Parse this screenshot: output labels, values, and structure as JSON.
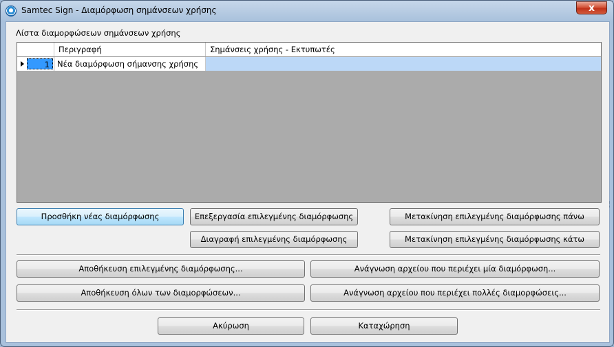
{
  "window": {
    "title": "Samtec Sign - Διαμόρφωση σημάνσεων χρήσης",
    "close_glyph": "x",
    "icon": "samtec-app-icon"
  },
  "group": {
    "label": "Λίστα διαμορφώσεων σημάνσεων χρήσης"
  },
  "grid": {
    "columns": [
      "Περιγραφή",
      "Σημάνσεις χρήσης - Εκτυπωτές"
    ],
    "rows": [
      {
        "number": "1",
        "description": "Νέα διαμόρφωση σήμανσης χρήσης",
        "labels_printers": ""
      }
    ]
  },
  "buttons": {
    "add": "Προσθήκη νέας διαμόρφωσης",
    "edit": "Επεξεργασία επιλεγμένης διαμόρφωσης",
    "delete": "Διαγραφή επιλεγμένης διαμόρφωσης",
    "move_up": "Μετακίνηση επιλεγμένης διαμόρφωσης πάνω",
    "move_down": "Μετακίνηση επιλεγμένης διαμόρφωσης κάτω",
    "save_selected": "Αποθήκευση επιλεγμένης διαμόρφωσης...",
    "save_all": "Αποθήκευση όλων των διαμορφώσεων...",
    "read_single": "Ανάγνωση αρχείου που περιέχει μία διαμόρφωση...",
    "read_multiple": "Ανάγνωση αρχείου που περιέχει πολλές διαμορφώσεις...",
    "cancel": "Ακύρωση",
    "submit": "Καταχώρηση"
  }
}
